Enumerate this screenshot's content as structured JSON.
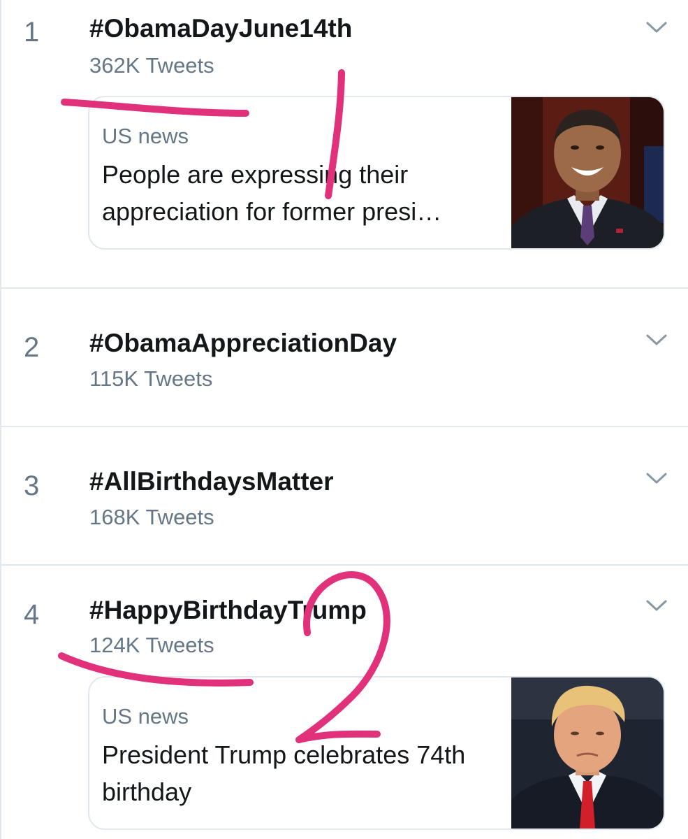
{
  "trends": [
    {
      "rank": "1",
      "hashtag": "#ObamaDayJune14th",
      "tweet_count": "362K Tweets",
      "card": {
        "category": "US news",
        "headline": "People are expressing their appreciation for former presi…"
      }
    },
    {
      "rank": "2",
      "hashtag": "#ObamaAppreciationDay",
      "tweet_count": "115K Tweets"
    },
    {
      "rank": "3",
      "hashtag": "#AllBirthdaysMatter",
      "tweet_count": "168K Tweets"
    },
    {
      "rank": "4",
      "hashtag": "#HappyBirthdayTrump",
      "tweet_count": "124K Tweets",
      "card": {
        "category": "US news",
        "headline": "President Trump celebrates 74th birthday"
      }
    }
  ],
  "icons": {
    "chevron": "chevron-down-icon"
  },
  "colors": {
    "primary_text": "#14171a",
    "secondary_text": "#657786",
    "divider": "#e1e8ed",
    "annotation": "#e0317a"
  }
}
